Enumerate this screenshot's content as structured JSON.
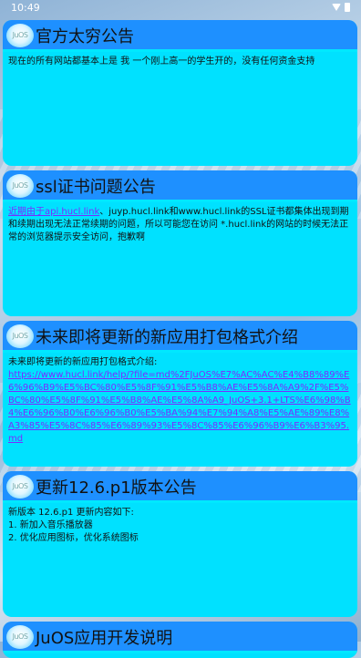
{
  "status": {
    "time": "10:49"
  },
  "logo_text": "JuOS",
  "cards": [
    {
      "title": "官方太穷公告",
      "body": "现在的所有网站都基本上是 我 一个刚上高一的学生开的，没有任何资金支持"
    },
    {
      "title": "ssl证书问题公告",
      "link": "近期由于api.hucl.link",
      "body": "、juyp.hucl.link和www.hucl.link的SSL证书都集体出现到期和续期出现无法正常续期的问题，所以可能您在访问 *.hucl.link的网站的时候无法正常的浏览器提示安全访问，抱歉啊"
    },
    {
      "title": "未来即将更新的新应用打包格式介绍",
      "intro": "未来即将更新的新应用打包格式介绍:",
      "link": "https://www.hucl.link/help/?file=md%2FJuOS%E7%AC%AC%E4%B8%89%E6%96%B9%E5%BC%80%E5%8F%91%E5%B8%AE%E5%8A%A9%2F%E5%BC%80%E5%8F%91%E5%B8%AE%E5%8A%A9_JuOS+3.1+LTS%E6%98%B4%E6%96%B0%E6%96%B0%E5%BA%94%E7%94%A8%E5%AE%89%E8%A3%85%E5%8C%85%E6%89%93%E5%8C%85%E6%96%B9%E6%B3%95.md"
    },
    {
      "title": "更新12.6.p1版本公告",
      "lines": [
        "新版本 12.6.p1 更新内容如下:",
        "1. 新加入音乐播放器",
        "2. 优化应用图标，优化系统图标"
      ]
    },
    {
      "title": "JuOS应用开发说明"
    }
  ]
}
